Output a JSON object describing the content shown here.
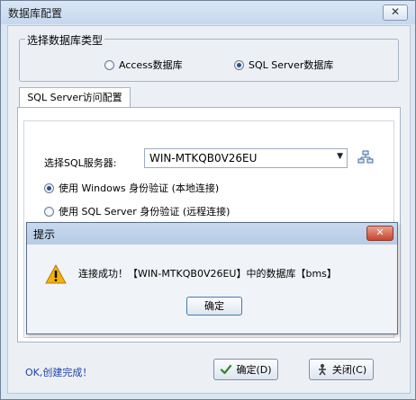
{
  "window": {
    "title": "数据库配置",
    "close_symbol": "✕"
  },
  "db_type": {
    "group_label": "选择数据库类型",
    "options": [
      {
        "label": "Access数据库",
        "checked": false
      },
      {
        "label": "SQL Server数据库",
        "checked": true
      }
    ]
  },
  "tab": {
    "label": "SQL Server访问配置"
  },
  "server": {
    "label": "选择SQL服务器:",
    "value": "WIN-MTKQB0V26EU",
    "dropdown_icon": "chevron-down-icon",
    "browse_icon": "network-icon"
  },
  "auth": {
    "options": [
      {
        "label": "使用 Windows 身份验证  (本地连接)",
        "checked": true
      },
      {
        "label": "使用 SQL Server 身份验证 (远程连接)",
        "checked": false
      }
    ]
  },
  "dialog": {
    "title": "提示",
    "close_symbol": "✕",
    "icon": "warning-icon",
    "message": "连接成功！【WIN-MTKQB0V26EU】中的数据库【bms】",
    "ok_label": "确定"
  },
  "footer": {
    "status": "OK,创建完成！",
    "confirm_label": "确定(D)",
    "close_label": "关闭(C)"
  },
  "colors": {
    "status_text": "#1c3fa8",
    "dialog_close": "#c8452c",
    "warning": "#f2b10f"
  }
}
